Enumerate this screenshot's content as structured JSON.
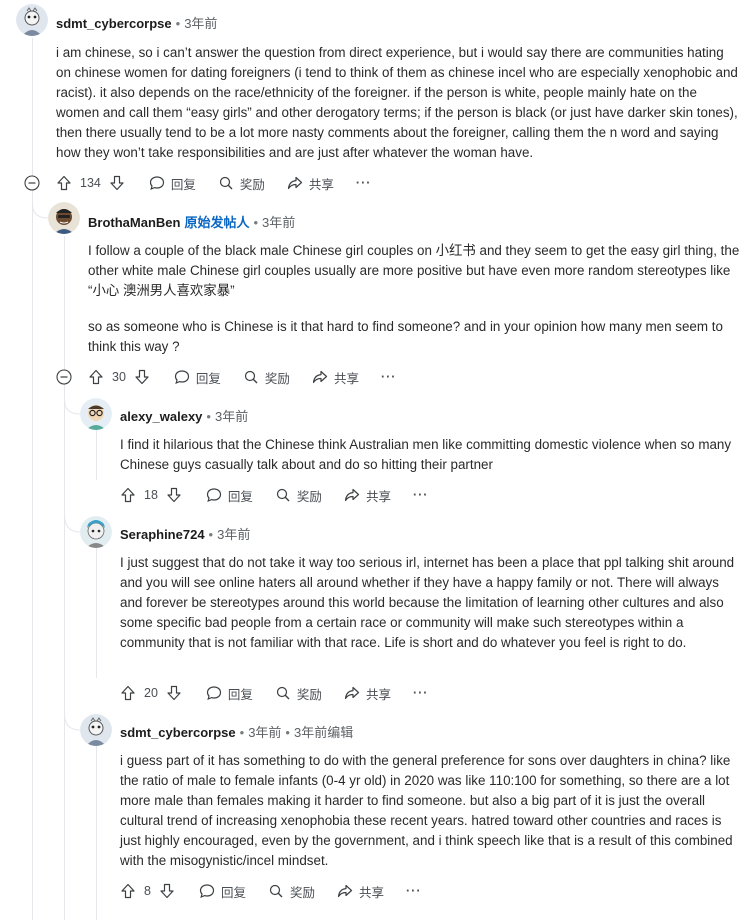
{
  "comments": [
    {
      "username": "sdmt_cybercorpse",
      "time": "3年前",
      "paragraphs": [
        "i am chinese, so i can’t answer the question from direct experience, but i would say there are communities hating on chinese women for dating foreigners (i tend to think of them as chinese incel who are especially xenophobic and racist). it also depends on the race/ethnicity of the foreigner. if the person is white, people mainly hate on the women and call them “easy girls” and other derogatory terms; if the person is black (or just have darker skin tones), then there usually tend to be a lot more nasty comments about the foreigner, calling them the n word and saying how they won’t take responsibilities and are just after whatever the woman have."
      ],
      "votes": "134"
    },
    {
      "username": "BrothaManBen",
      "op_badge": "原始发帖人",
      "time": "3年前",
      "paragraphs": [
        "I follow a couple of the black male Chinese girl couples on 小红书 and they seem to get the easy girl thing, the other white male Chinese girl couples usually are more positive but have even more random stereotypes like “小心 澳洲男人喜欢家暴”",
        "so as someone who is Chinese is it that hard to find someone? and in your opinion how many men seem to think this way ?"
      ],
      "votes": "30"
    },
    {
      "username": "alexy_walexy",
      "time": "3年前",
      "paragraphs": [
        "I find it hilarious that the Chinese think Australian men like committing domestic violence when so many Chinese guys casually talk about and do so hitting their partner"
      ],
      "votes": "18"
    },
    {
      "username": "Seraphine724",
      "time": "3年前",
      "paragraphs": [
        "I just suggest that do not take it way too serious irl, internet has been a place that ppl talking shit around and you will see online haters all around whether if they have a happy family or not. There will always and forever be stereotypes around this world because the limitation of learning other cultures and also some specific bad people from a certain race or community will make such stereotypes within a community that is not familiar with that race. Life is short and do whatever you feel is right to do."
      ],
      "votes": "20"
    },
    {
      "username": "sdmt_cybercorpse",
      "time": "3年前",
      "edited": "3年前编辑",
      "paragraphs": [
        "i guess part of it has something to do with the general preference for sons over daughters in china? like the ratio of male to female infants (0-4 yr old) in 2020 was like 110:100 for something, so there are a lot more male than females making it harder to find someone. but also a big part of it is just the overall cultural trend of increasing xenophobia these recent years. hatred toward other countries and races is just highly encouraged, even by the government, and i think speech like that is a result of this combined with the misogynistic/incel mindset."
      ],
      "votes": "8"
    }
  ],
  "actions": {
    "reply": "回复",
    "award": "奖励",
    "share": "共享",
    "more": "···"
  },
  "icons": {
    "upvote": "upvote-icon",
    "downvote": "downvote-icon",
    "reply": "comment-bubble-icon",
    "award": "award-icon",
    "share": "share-arrow-icon",
    "collapse": "collapse-minus-icon"
  },
  "colors": {
    "op_badge": "#0a66c2",
    "thread_line": "#e5e7ea"
  }
}
